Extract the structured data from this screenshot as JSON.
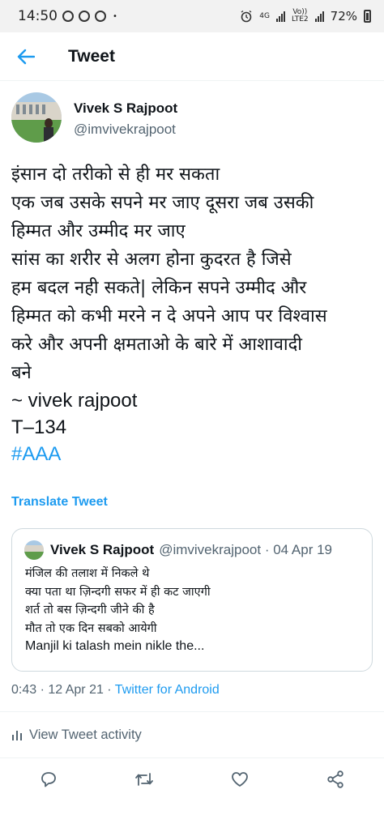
{
  "status_bar": {
    "time": "14:50",
    "dot": "•",
    "network_4g": "4G",
    "network_volte_top": "Vo))",
    "network_volte_bottom": "LTE2",
    "battery": "72%"
  },
  "header": {
    "title": "Tweet"
  },
  "author": {
    "name": "Vivek S Rajpoot",
    "handle": "@imvivekrajpoot"
  },
  "tweet": {
    "lines": [
      "इंसान दो तरीको से ही मर सकता",
      "एक जब उसके सपने मर जाए दूसरा जब उसकी",
      "हिम्मत और उम्मीद मर जाए",
      "सांस का शरीर से अलग होना कुदरत है जिसे",
      "हम बदल नही सकते| लेकिन सपने उम्मीद और",
      "हिम्मत को कभी मरने न दे अपने आप पर विश्वास",
      "करे और अपनी क्षमताओ के बारे में आशावादी",
      "बने"
    ],
    "signature": "~ vivek rajpoot",
    "code": "T–134",
    "hashtag": "#AAA"
  },
  "translate_label": "Translate Tweet",
  "quoted_tweet": {
    "name": "Vivek S Rajpoot",
    "meta": "@imvivekrajpoot · 04 Apr 19",
    "lines": [
      "मंजिल की तलाश में निकले थे",
      "क्या पता था ज़िन्दगी सफर में ही कट जाएगी",
      "शर्त तो बस ज़िन्दगी जीने की है",
      "मौत तो एक दिन सबको आयेगी"
    ],
    "latin_line": "Manjil ki talash mein nikle the..."
  },
  "timestamp": {
    "time_date": "0:43 · 12 Apr 21 · ",
    "source": "Twitter for Android"
  },
  "activity_label": "View Tweet activity",
  "icons": {
    "back": "back-arrow-icon",
    "reply": "reply-icon",
    "retweet": "retweet-icon",
    "like": "like-icon",
    "share": "share-icon",
    "activity": "activity-chart-icon"
  },
  "colors": {
    "accent": "#1d9bf0",
    "secondary_text": "#536471",
    "primary_text": "#0f1419"
  }
}
